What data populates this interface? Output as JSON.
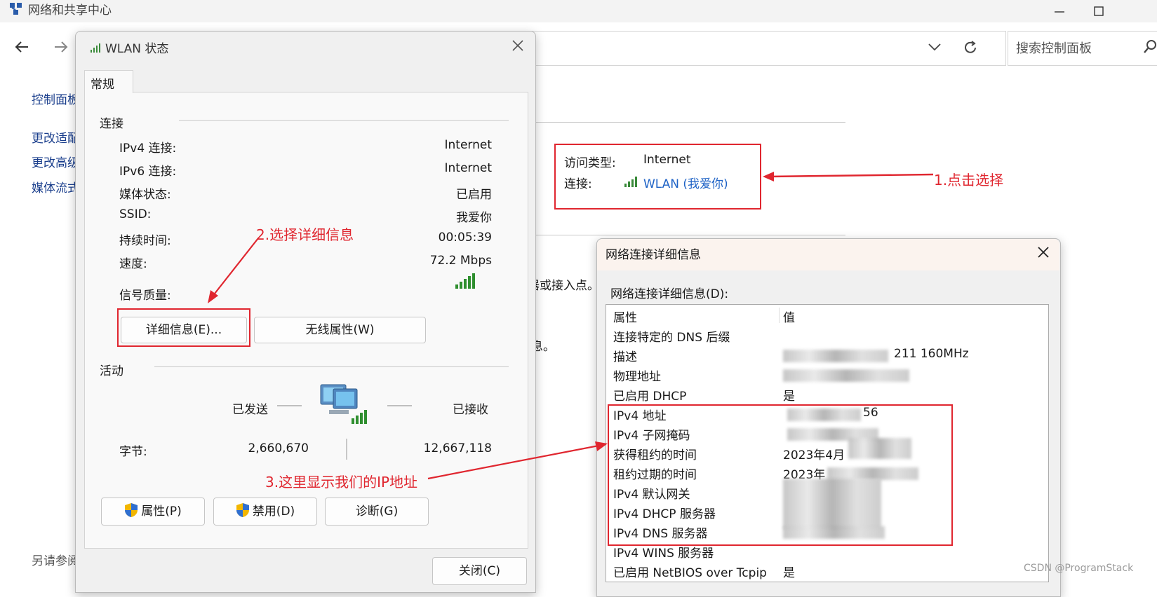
{
  "app": {
    "title": "网络和共享中心",
    "search_placeholder": "搜索控制面板"
  },
  "left_nav": {
    "home": "控制面板",
    "items": [
      "更改适配",
      "更改高级",
      "媒体流式"
    ],
    "see_also": "另请参阅"
  },
  "access": {
    "type_label": "访问类型:",
    "type_value": "Internet",
    "connection_label": "连接:",
    "connection_value": "WLAN (我爱你)"
  },
  "bg_text": {
    "line1": "器或接入点。",
    "line2": "息。"
  },
  "wlan_dialog": {
    "title": "WLAN 状态",
    "tab": "常规",
    "connection_section": "连接",
    "rows": [
      {
        "label": "IPv4 连接:",
        "value": "Internet"
      },
      {
        "label": "IPv6 连接:",
        "value": "Internet"
      },
      {
        "label": "媒体状态:",
        "value": "已启用"
      },
      {
        "label": "SSID:",
        "value": "我爱你"
      },
      {
        "label": "持续时间:",
        "value": "00:05:39"
      },
      {
        "label": "速度:",
        "value": "72.2 Mbps"
      }
    ],
    "signal_label": "信号质量:",
    "details_button": "详细信息(E)...",
    "wireless_button": "无线属性(W)",
    "activity_section": "活动",
    "sent_label": "已发送",
    "received_label": "已接收",
    "bytes_label": "字节:",
    "bytes_sent": "2,660,670",
    "bytes_received": "12,667,118",
    "properties_button": "属性(P)",
    "disable_button": "禁用(D)",
    "diagnose_button": "诊断(G)",
    "close_button": "关闭(C)"
  },
  "details_dialog": {
    "title": "网络连接详细信息",
    "caption": "网络连接详细信息(D):",
    "col_property": "属性",
    "col_value": "值",
    "rows": [
      {
        "property": "连接特定的 DNS 后缀",
        "value": ""
      },
      {
        "property": "描述",
        "value": "211 160MHz"
      },
      {
        "property": "物理地址",
        "value": ""
      },
      {
        "property": "已启用 DHCP",
        "value": "是"
      },
      {
        "property": "IPv4 地址",
        "value": "56"
      },
      {
        "property": "IPv4 子网掩码",
        "value": ""
      },
      {
        "property": "获得租约的时间",
        "value": "2023年4月"
      },
      {
        "property": "租约过期的时间",
        "value": "2023年"
      },
      {
        "property": "IPv4 默认网关",
        "value": ""
      },
      {
        "property": "IPv4 DHCP 服务器",
        "value": ""
      },
      {
        "property": "IPv4 DNS 服务器",
        "value": ""
      },
      {
        "property": "IPv4 WINS 服务器",
        "value": ""
      },
      {
        "property": "已启用 NetBIOS over Tcpip",
        "value": "是"
      }
    ]
  },
  "annotations": {
    "step1": "1.点击选择",
    "step2": "2.选择详细信息",
    "step3": "3.这里显示我们的IP地址",
    "color": "#e0262f"
  },
  "watermark": "CSDN @ProgramStack"
}
